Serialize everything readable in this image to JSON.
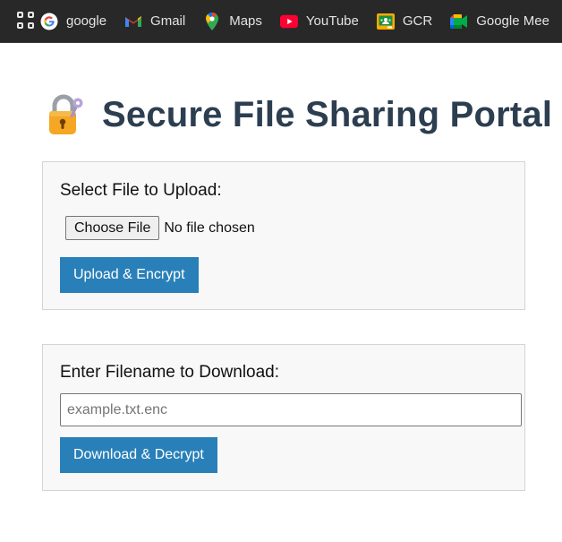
{
  "bookmarks": [
    {
      "label": "google",
      "icon": "google-icon"
    },
    {
      "label": "Gmail",
      "icon": "gmail-icon"
    },
    {
      "label": "Maps",
      "icon": "maps-icon"
    },
    {
      "label": "YouTube",
      "icon": "youtube-icon"
    },
    {
      "label": "GCR",
      "icon": "classroom-icon"
    },
    {
      "label": "Google Mee",
      "icon": "meet-icon"
    }
  ],
  "page": {
    "title": "Secure File Sharing Portal",
    "title_icon": "lock-with-key-icon"
  },
  "upload": {
    "label": "Select File to Upload:",
    "choose_label": "Choose File",
    "file_status": "No file chosen",
    "button_label": "Upload & Encrypt"
  },
  "download": {
    "label": "Enter Filename to Download:",
    "input_value": "",
    "placeholder": "example.txt.enc",
    "button_label": "Download & Decrypt"
  },
  "colors": {
    "bookmarks_bar": "#282828",
    "title": "#2c3e50",
    "button": "#2980b9",
    "panel_bg": "#f8f8f8"
  }
}
